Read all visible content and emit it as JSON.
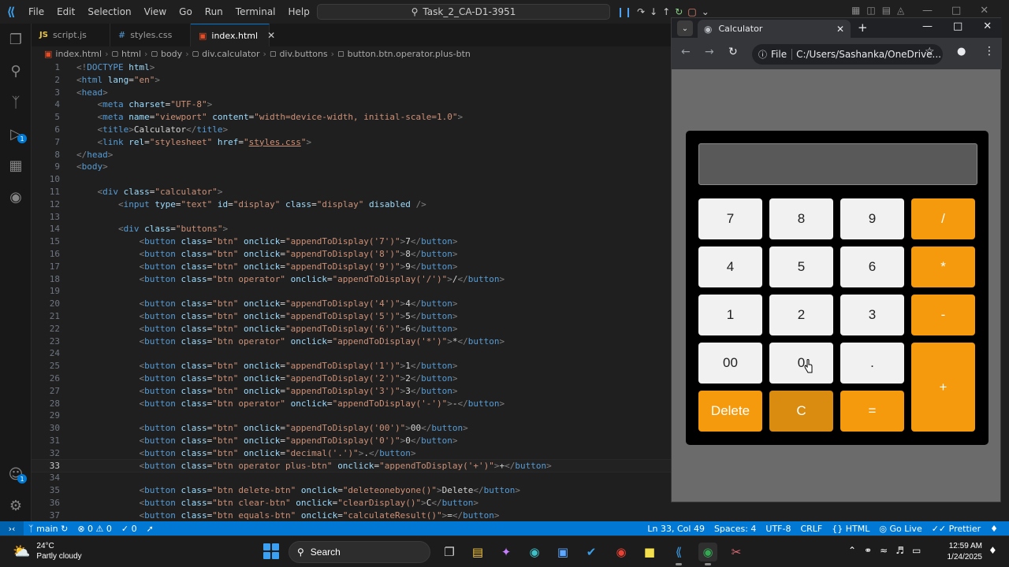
{
  "titlebar": {
    "menu": [
      "File",
      "Edit",
      "Selection",
      "View",
      "Go",
      "Run",
      "Terminal",
      "Help"
    ],
    "search": "Task_2_CA-D1-3951"
  },
  "tabs": [
    {
      "label": "script.js",
      "icon": "js-file-icon"
    },
    {
      "label": "styles.css",
      "icon": "css-file-icon"
    },
    {
      "label": "index.html",
      "icon": "html-file-icon",
      "active": true
    }
  ],
  "breadcrumb": [
    "index.html",
    "html",
    "body",
    "div.calculator",
    "div.buttons",
    "button.btn.operator.plus-btn"
  ],
  "editor": {
    "current_line": 33,
    "lines": [
      {
        "n": "1",
        "html": "<span class='t-pun'>&lt;!</span><span class='t-tag'>DOCTYPE</span> <span class='t-attr'>html</span><span class='t-pun'>&gt;</span>"
      },
      {
        "n": "2",
        "html": "<span class='t-pun'>&lt;</span><span class='t-tag'>html</span> <span class='t-attr'>lang</span><span class='t-txt'>=</span><span class='t-str'>\"en\"</span><span class='t-pun'>&gt;</span>"
      },
      {
        "n": "3",
        "html": "<span class='t-pun'>&lt;</span><span class='t-tag'>head</span><span class='t-pun'>&gt;</span>"
      },
      {
        "n": "4",
        "html": "    <span class='t-pun'>&lt;</span><span class='t-tag'>meta</span> <span class='t-attr'>charset</span><span class='t-txt'>=</span><span class='t-str'>\"UTF-8\"</span><span class='t-pun'>&gt;</span>"
      },
      {
        "n": "5",
        "html": "    <span class='t-pun'>&lt;</span><span class='t-tag'>meta</span> <span class='t-attr'>name</span><span class='t-txt'>=</span><span class='t-str'>\"viewport\"</span> <span class='t-attr'>content</span><span class='t-txt'>=</span><span class='t-str'>\"width=device-width, initial-scale=1.0\"</span><span class='t-pun'>&gt;</span>"
      },
      {
        "n": "6",
        "html": "    <span class='t-pun'>&lt;</span><span class='t-tag'>title</span><span class='t-pun'>&gt;</span><span class='t-txt'>Calculator</span><span class='t-pun'>&lt;/</span><span class='t-tag'>title</span><span class='t-pun'>&gt;</span>"
      },
      {
        "n": "7",
        "html": "    <span class='t-pun'>&lt;</span><span class='t-tag'>link</span> <span class='t-attr'>rel</span><span class='t-txt'>=</span><span class='t-str'>\"stylesheet\"</span> <span class='t-attr'>href</span><span class='t-txt'>=</span><span class='t-str'>\"</span><span class='t-link'>styles.css</span><span class='t-str'>\"</span><span class='t-pun'>&gt;</span>"
      },
      {
        "n": "8",
        "html": "<span class='t-pun'>&lt;/</span><span class='t-tag'>head</span><span class='t-pun'>&gt;</span>"
      },
      {
        "n": "9",
        "html": "<span class='t-pun'>&lt;</span><span class='t-tag'>body</span><span class='t-pun'>&gt;</span>"
      },
      {
        "n": "10",
        "html": ""
      },
      {
        "n": "11",
        "html": "    <span class='t-pun'>&lt;</span><span class='t-tag'>div</span> <span class='t-attr'>class</span><span class='t-txt'>=</span><span class='t-str'>\"calculator\"</span><span class='t-pun'>&gt;</span>"
      },
      {
        "n": "12",
        "html": "        <span class='t-pun'>&lt;</span><span class='t-tag'>input</span> <span class='t-attr'>type</span><span class='t-txt'>=</span><span class='t-str'>\"text\"</span> <span class='t-attr'>id</span><span class='t-txt'>=</span><span class='t-str'>\"display\"</span> <span class='t-attr'>class</span><span class='t-txt'>=</span><span class='t-str'>\"display\"</span> <span class='t-attr'>disabled</span> <span class='t-pun'>/&gt;</span>"
      },
      {
        "n": "13",
        "html": ""
      },
      {
        "n": "14",
        "html": "        <span class='t-pun'>&lt;</span><span class='t-tag'>div</span> <span class='t-attr'>class</span><span class='t-txt'>=</span><span class='t-str'>\"buttons\"</span><span class='t-pun'>&gt;</span>"
      },
      {
        "n": "15",
        "html": "            <span class='t-pun'>&lt;</span><span class='t-tag'>button</span> <span class='t-attr'>class</span><span class='t-txt'>=</span><span class='t-str'>\"btn\"</span> <span class='t-attr'>onclick</span><span class='t-txt'>=</span><span class='t-str'>\"appendToDisplay('7')\"</span><span class='t-pun'>&gt;</span><span class='t-txt'>7</span><span class='t-pun'>&lt;/</span><span class='t-tag'>button</span><span class='t-pun'>&gt;</span>"
      },
      {
        "n": "16",
        "html": "            <span class='t-pun'>&lt;</span><span class='t-tag'>button</span> <span class='t-attr'>class</span><span class='t-txt'>=</span><span class='t-str'>\"btn\"</span> <span class='t-attr'>onclick</span><span class='t-txt'>=</span><span class='t-str'>\"appendToDisplay('8')\"</span><span class='t-pun'>&gt;</span><span class='t-txt'>8</span><span class='t-pun'>&lt;/</span><span class='t-tag'>button</span><span class='t-pun'>&gt;</span>"
      },
      {
        "n": "17",
        "html": "            <span class='t-pun'>&lt;</span><span class='t-tag'>button</span> <span class='t-attr'>class</span><span class='t-txt'>=</span><span class='t-str'>\"btn\"</span> <span class='t-attr'>onclick</span><span class='t-txt'>=</span><span class='t-str'>\"appendToDisplay('9')\"</span><span class='t-pun'>&gt;</span><span class='t-txt'>9</span><span class='t-pun'>&lt;/</span><span class='t-tag'>button</span><span class='t-pun'>&gt;</span>"
      },
      {
        "n": "18",
        "html": "            <span class='t-pun'>&lt;</span><span class='t-tag'>button</span> <span class='t-attr'>class</span><span class='t-txt'>=</span><span class='t-str'>\"btn operator\"</span> <span class='t-attr'>onclick</span><span class='t-txt'>=</span><span class='t-str'>\"appendToDisplay('/')\"</span><span class='t-pun'>&gt;</span><span class='t-txt'>/</span><span class='t-pun'>&lt;/</span><span class='t-tag'>button</span><span class='t-pun'>&gt;</span>"
      },
      {
        "n": "19",
        "html": ""
      },
      {
        "n": "20",
        "html": "            <span class='t-pun'>&lt;</span><span class='t-tag'>button</span> <span class='t-attr'>class</span><span class='t-txt'>=</span><span class='t-str'>\"btn\"</span> <span class='t-attr'>onclick</span><span class='t-txt'>=</span><span class='t-str'>\"appendToDisplay('4')\"</span><span class='t-pun'>&gt;</span><span class='t-txt'>4</span><span class='t-pun'>&lt;/</span><span class='t-tag'>button</span><span class='t-pun'>&gt;</span>"
      },
      {
        "n": "21",
        "html": "            <span class='t-pun'>&lt;</span><span class='t-tag'>button</span> <span class='t-attr'>class</span><span class='t-txt'>=</span><span class='t-str'>\"btn\"</span> <span class='t-attr'>onclick</span><span class='t-txt'>=</span><span class='t-str'>\"appendToDisplay('5')\"</span><span class='t-pun'>&gt;</span><span class='t-txt'>5</span><span class='t-pun'>&lt;/</span><span class='t-tag'>button</span><span class='t-pun'>&gt;</span>"
      },
      {
        "n": "22",
        "html": "            <span class='t-pun'>&lt;</span><span class='t-tag'>button</span> <span class='t-attr'>class</span><span class='t-txt'>=</span><span class='t-str'>\"btn\"</span> <span class='t-attr'>onclick</span><span class='t-txt'>=</span><span class='t-str'>\"appendToDisplay('6')\"</span><span class='t-pun'>&gt;</span><span class='t-txt'>6</span><span class='t-pun'>&lt;/</span><span class='t-tag'>button</span><span class='t-pun'>&gt;</span>"
      },
      {
        "n": "23",
        "html": "            <span class='t-pun'>&lt;</span><span class='t-tag'>button</span> <span class='t-attr'>class</span><span class='t-txt'>=</span><span class='t-str'>\"btn operator\"</span> <span class='t-attr'>onclick</span><span class='t-txt'>=</span><span class='t-str'>\"appendToDisplay('*')\"</span><span class='t-pun'>&gt;</span><span class='t-txt'>*</span><span class='t-pun'>&lt;/</span><span class='t-tag'>button</span><span class='t-pun'>&gt;</span>"
      },
      {
        "n": "24",
        "html": ""
      },
      {
        "n": "25",
        "html": "            <span class='t-pun'>&lt;</span><span class='t-tag'>button</span> <span class='t-attr'>class</span><span class='t-txt'>=</span><span class='t-str'>\"btn\"</span> <span class='t-attr'>onclick</span><span class='t-txt'>=</span><span class='t-str'>\"appendToDisplay('1')\"</span><span class='t-pun'>&gt;</span><span class='t-txt'>1</span><span class='t-pun'>&lt;/</span><span class='t-tag'>button</span><span class='t-pun'>&gt;</span>"
      },
      {
        "n": "26",
        "html": "            <span class='t-pun'>&lt;</span><span class='t-tag'>button</span> <span class='t-attr'>class</span><span class='t-txt'>=</span><span class='t-str'>\"btn\"</span> <span class='t-attr'>onclick</span><span class='t-txt'>=</span><span class='t-str'>\"appendToDisplay('2')\"</span><span class='t-pun'>&gt;</span><span class='t-txt'>2</span><span class='t-pun'>&lt;/</span><span class='t-tag'>button</span><span class='t-pun'>&gt;</span>"
      },
      {
        "n": "27",
        "html": "            <span class='t-pun'>&lt;</span><span class='t-tag'>button</span> <span class='t-attr'>class</span><span class='t-txt'>=</span><span class='t-str'>\"btn\"</span> <span class='t-attr'>onclick</span><span class='t-txt'>=</span><span class='t-str'>\"appendToDisplay('3')\"</span><span class='t-pun'>&gt;</span><span class='t-txt'>3</span><span class='t-pun'>&lt;/</span><span class='t-tag'>button</span><span class='t-pun'>&gt;</span>"
      },
      {
        "n": "28",
        "html": "            <span class='t-pun'>&lt;</span><span class='t-tag'>button</span> <span class='t-attr'>class</span><span class='t-txt'>=</span><span class='t-str'>\"btn operator\"</span> <span class='t-attr'>onclick</span><span class='t-txt'>=</span><span class='t-str'>\"appendToDisplay('-')\"</span><span class='t-pun'>&gt;</span><span class='t-txt'>-</span><span class='t-pun'>&lt;/</span><span class='t-tag'>button</span><span class='t-pun'>&gt;</span>"
      },
      {
        "n": "29",
        "html": ""
      },
      {
        "n": "30",
        "html": "            <span class='t-pun'>&lt;</span><span class='t-tag'>button</span> <span class='t-attr'>class</span><span class='t-txt'>=</span><span class='t-str'>\"btn\"</span> <span class='t-attr'>onclick</span><span class='t-txt'>=</span><span class='t-str'>\"appendToDisplay('00')\"</span><span class='t-pun'>&gt;</span><span class='t-txt'>00</span><span class='t-pun'>&lt;/</span><span class='t-tag'>button</span><span class='t-pun'>&gt;</span>"
      },
      {
        "n": "31",
        "html": "            <span class='t-pun'>&lt;</span><span class='t-tag'>button</span> <span class='t-attr'>class</span><span class='t-txt'>=</span><span class='t-str'>\"btn\"</span> <span class='t-attr'>onclick</span><span class='t-txt'>=</span><span class='t-str'>\"appendToDisplay('0')\"</span><span class='t-pun'>&gt;</span><span class='t-txt'>0</span><span class='t-pun'>&lt;/</span><span class='t-tag'>button</span><span class='t-pun'>&gt;</span>"
      },
      {
        "n": "32",
        "html": "            <span class='t-pun'>&lt;</span><span class='t-tag'>button</span> <span class='t-attr'>class</span><span class='t-txt'>=</span><span class='t-str'>\"btn\"</span> <span class='t-attr'>onclick</span><span class='t-txt'>=</span><span class='t-str'>\"decimal('.')\"</span><span class='t-pun'>&gt;</span><span class='t-txt'>.</span><span class='t-pun'>&lt;/</span><span class='t-tag'>button</span><span class='t-pun'>&gt;</span>"
      },
      {
        "n": "33",
        "html": "            <span class='t-pun'>&lt;</span><span class='t-tag'>button</span> <span class='t-attr'>class</span><span class='t-txt'>=</span><span class='t-str'>\"btn operator plus-btn\"</span> <span class='t-attr'>onclick</span><span class='t-txt'>=</span><span class='t-str'>\"appendToDisplay('+')\"</span><span class='t-pun'>&gt;</span><span class='t-txt'>+</span><span class='t-pun'>&lt;/</span><span class='t-tag'>button</span><span class='t-pun'>&gt;</span>"
      },
      {
        "n": "34",
        "html": ""
      },
      {
        "n": "35",
        "html": "            <span class='t-pun'>&lt;</span><span class='t-tag'>button</span> <span class='t-attr'>class</span><span class='t-txt'>=</span><span class='t-str'>\"btn delete-btn\"</span> <span class='t-attr'>onclick</span><span class='t-txt'>=</span><span class='t-str'>\"deleteonebyone()\"</span><span class='t-pun'>&gt;</span><span class='t-txt'>Delete</span><span class='t-pun'>&lt;/</span><span class='t-tag'>button</span><span class='t-pun'>&gt;</span>"
      },
      {
        "n": "36",
        "html": "            <span class='t-pun'>&lt;</span><span class='t-tag'>button</span> <span class='t-attr'>class</span><span class='t-txt'>=</span><span class='t-str'>\"btn clear-btn\"</span> <span class='t-attr'>onclick</span><span class='t-txt'>=</span><span class='t-str'>\"clearDisplay()\"</span><span class='t-pun'>&gt;</span><span class='t-txt'>C</span><span class='t-pun'>&lt;/</span><span class='t-tag'>button</span><span class='t-pun'>&gt;</span>"
      },
      {
        "n": "37",
        "html": "            <span class='t-pun'>&lt;</span><span class='t-tag'>button</span> <span class='t-attr'>class</span><span class='t-txt'>=</span><span class='t-str'>\"btn equals-btn\"</span> <span class='t-attr'>onclick</span><span class='t-txt'>=</span><span class='t-str'>\"calculateResult()\"</span><span class='t-pun'>&gt;</span><span class='t-txt'>=</span><span class='t-pun'>&lt;/</span><span class='t-tag'>button</span><span class='t-pun'>&gt;</span>"
      }
    ]
  },
  "browser": {
    "tab_title": "Calculator",
    "address_chip": "File",
    "address": "C:/Users/Sashanka/OneDrive...",
    "calculator": {
      "display_value": "",
      "buttons": [
        {
          "label": "7",
          "kind": "num",
          "name": "btn-7"
        },
        {
          "label": "8",
          "kind": "num",
          "name": "btn-8"
        },
        {
          "label": "9",
          "kind": "num",
          "name": "btn-9"
        },
        {
          "label": "/",
          "kind": "op",
          "name": "btn-divide"
        },
        {
          "label": "4",
          "kind": "num",
          "name": "btn-4"
        },
        {
          "label": "5",
          "kind": "num",
          "name": "btn-5"
        },
        {
          "label": "6",
          "kind": "num",
          "name": "btn-6"
        },
        {
          "label": "*",
          "kind": "op",
          "name": "btn-multiply"
        },
        {
          "label": "1",
          "kind": "num",
          "name": "btn-1"
        },
        {
          "label": "2",
          "kind": "num",
          "name": "btn-2"
        },
        {
          "label": "3",
          "kind": "num",
          "name": "btn-3"
        },
        {
          "label": "-",
          "kind": "op",
          "name": "btn-subtract"
        },
        {
          "label": "00",
          "kind": "num",
          "name": "btn-00"
        },
        {
          "label": "0",
          "kind": "num",
          "name": "btn-0"
        },
        {
          "label": ".",
          "kind": "num",
          "name": "btn-decimal"
        },
        {
          "label": "+",
          "kind": "op",
          "name": "btn-plus"
        },
        {
          "label": "Delete",
          "kind": "op",
          "name": "btn-delete"
        },
        {
          "label": "C",
          "kind": "clear",
          "name": "btn-clear"
        },
        {
          "label": "=",
          "kind": "op",
          "name": "btn-equals"
        }
      ]
    }
  },
  "statusbar": {
    "branch": "main",
    "errors": "0",
    "warnings": "0",
    "ports": "0",
    "position": "Ln 33, Col 49",
    "spaces": "Spaces: 4",
    "encoding": "UTF-8",
    "eol": "CRLF",
    "language": "HTML",
    "golive": "Go Live",
    "prettier": "Prettier"
  },
  "taskbar": {
    "temperature": "24°C",
    "weather": "Partly cloudy",
    "search": "Search",
    "time": "12:59 AM",
    "date": "1/24/2025"
  },
  "colors": {
    "operator": "#f59a0c",
    "clear": "#d98c10",
    "number": "#f1f1f1",
    "statusbar": "#0078d4"
  }
}
